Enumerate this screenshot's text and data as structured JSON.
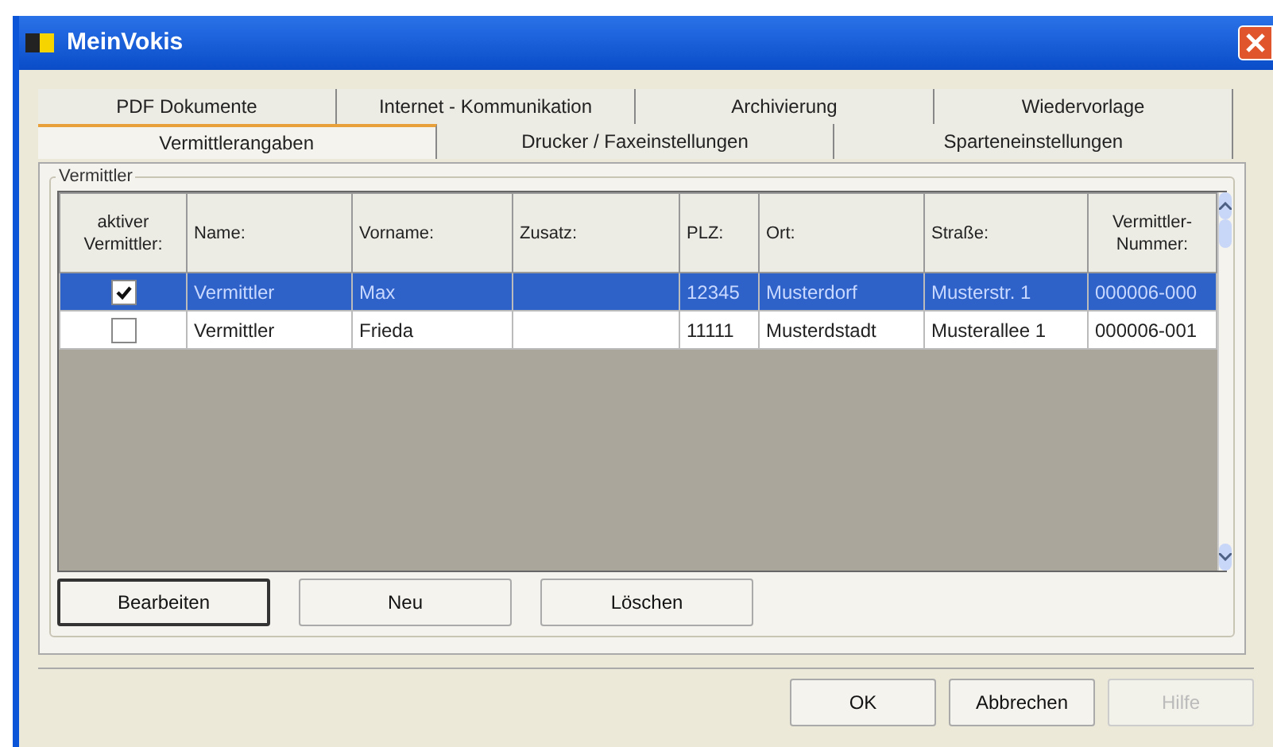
{
  "window": {
    "title": "MeinVokis"
  },
  "tabs": [
    [
      {
        "label": "PDF Dokumente",
        "selected": false
      },
      {
        "label": "Internet - Kommunikation",
        "selected": false
      },
      {
        "label": "Archivierung",
        "selected": false
      },
      {
        "label": "Wiedervorlage",
        "selected": false
      }
    ],
    [
      {
        "label": "Vermittlerangaben",
        "selected": true
      },
      {
        "label": "Drucker / Faxeinstellungen",
        "selected": false
      },
      {
        "label": "Sparteneinstellungen",
        "selected": false
      }
    ]
  ],
  "group": {
    "title": "Vermittler"
  },
  "table": {
    "columns": [
      "aktiver Vermittler:",
      "Name:",
      "Vorname:",
      "Zusatz:",
      "PLZ:",
      "Ort:",
      "Straße:",
      "Vermittler-Nummer:"
    ],
    "rows": [
      {
        "checked": true,
        "selected": true,
        "cells": [
          "",
          "Vermittler",
          "Max",
          "",
          "12345",
          "Musterdorf",
          "Musterstr. 1",
          "000006-000"
        ]
      },
      {
        "checked": false,
        "selected": false,
        "cells": [
          "",
          "Vermittler",
          "Frieda",
          "",
          "11111",
          "Musterdstadt",
          "Musterallee 1",
          "000006-001"
        ]
      }
    ]
  },
  "row_buttons": [
    {
      "label": "Bearbeiten",
      "disabled": false
    },
    {
      "label": "Neu",
      "disabled": false
    },
    {
      "label": "Löschen",
      "disabled": false
    }
  ],
  "dialog_buttons": [
    {
      "label": "OK",
      "disabled": false
    },
    {
      "label": "Abbrechen",
      "disabled": false
    },
    {
      "label": "Hilfe",
      "disabled": true
    }
  ]
}
